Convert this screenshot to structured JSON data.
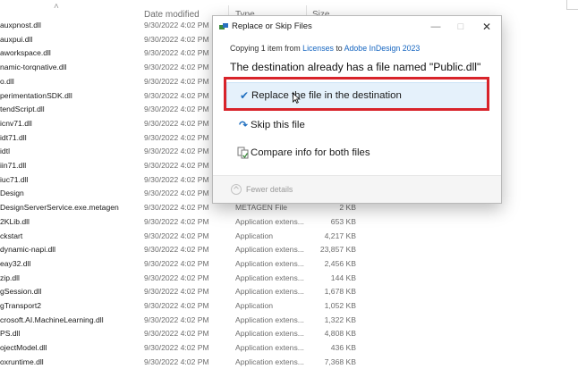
{
  "explorer": {
    "columns": {
      "date": "Date modified",
      "type": "Type",
      "size": "Size"
    },
    "files": [
      {
        "name": "auxpnost.dll",
        "date": "9/30/2022 4:02 PM",
        "type": "",
        "size": ""
      },
      {
        "name": "auxpui.dll",
        "date": "9/30/2022 4:02 PM",
        "type": "",
        "size": ""
      },
      {
        "name": "aworkspace.dll",
        "date": "9/30/2022 4:02 PM",
        "type": "",
        "size": ""
      },
      {
        "name": "namic-torqnative.dll",
        "date": "9/30/2022 4:02 PM",
        "type": "",
        "size": ""
      },
      {
        "name": "o.dll",
        "date": "9/30/2022 4:02 PM",
        "type": "",
        "size": ""
      },
      {
        "name": "perimentationSDK.dll",
        "date": "9/30/2022 4:02 PM",
        "type": "",
        "size": ""
      },
      {
        "name": "tendScript.dll",
        "date": "9/30/2022 4:02 PM",
        "type": "",
        "size": ""
      },
      {
        "name": "icnv71.dll",
        "date": "9/30/2022 4:02 PM",
        "type": "",
        "size": ""
      },
      {
        "name": "idt71.dll",
        "date": "9/30/2022 4:02 PM",
        "type": "",
        "size": ""
      },
      {
        "name": "idtl",
        "date": "9/30/2022 4:02 PM",
        "type": "",
        "size": ""
      },
      {
        "name": "iin71.dll",
        "date": "9/30/2022 4:02 PM",
        "type": "",
        "size": ""
      },
      {
        "name": "iuc71.dll",
        "date": "9/30/2022 4:02 PM",
        "type": "",
        "size": ""
      },
      {
        "name": "Design",
        "date": "9/30/2022 4:02 PM",
        "type": "",
        "size": ""
      },
      {
        "name": "DesignServerService.exe.metagen",
        "date": "9/30/2022 4:02 PM",
        "type": "METAGEN File",
        "size": "2 KB"
      },
      {
        "name": "2KLib.dll",
        "date": "9/30/2022 4:02 PM",
        "type": "Application extens...",
        "size": "653 KB"
      },
      {
        "name": "ckstart",
        "date": "9/30/2022 4:02 PM",
        "type": "Application",
        "size": "4,217 KB"
      },
      {
        "name": "dynamic-napi.dll",
        "date": "9/30/2022 4:02 PM",
        "type": "Application extens...",
        "size": "23,857 KB"
      },
      {
        "name": "eay32.dll",
        "date": "9/30/2022 4:02 PM",
        "type": "Application extens...",
        "size": "2,456 KB"
      },
      {
        "name": "zip.dll",
        "date": "9/30/2022 4:02 PM",
        "type": "Application extens...",
        "size": "144 KB"
      },
      {
        "name": "gSession.dll",
        "date": "9/30/2022 4:02 PM",
        "type": "Application extens...",
        "size": "1,678 KB"
      },
      {
        "name": "gTransport2",
        "date": "9/30/2022 4:02 PM",
        "type": "Application",
        "size": "1,052 KB"
      },
      {
        "name": "crosoft.AI.MachineLearning.dll",
        "date": "9/30/2022 4:02 PM",
        "type": "Application extens...",
        "size": "1,322 KB"
      },
      {
        "name": "PS.dll",
        "date": "9/30/2022 4:02 PM",
        "type": "Application extens...",
        "size": "4,808 KB"
      },
      {
        "name": "ojectModel.dll",
        "date": "9/30/2022 4:02 PM",
        "type": "Application extens...",
        "size": "436 KB"
      },
      {
        "name": "oxruntime.dll",
        "date": "9/30/2022 4:02 PM",
        "type": "Application extens...",
        "size": "7,368 KB"
      }
    ]
  },
  "dialog": {
    "title": "Replace or Skip Files",
    "copying_prefix": "Copying 1 item from ",
    "source": "Licenses",
    "to_word": " to ",
    "destination": "Adobe InDesign 2023",
    "heading": "The destination already has a file named \"Public.dll\"",
    "options": {
      "replace": "Replace the file in the destination",
      "skip": "Skip this file",
      "compare": "Compare info for both files"
    },
    "fewer_details": "Fewer details",
    "controls": {
      "minimize": "—",
      "maximize": "□",
      "close": "✕"
    }
  },
  "icons": {
    "replace": "checkmark-icon",
    "skip": "skip-arrow-icon",
    "compare": "compare-files-icon"
  },
  "colors": {
    "link": "#1565c0",
    "accent_icon": "#1f6fc0",
    "selected_option_bg": "#e5f1fb",
    "annotation_red": "#d8232a"
  }
}
